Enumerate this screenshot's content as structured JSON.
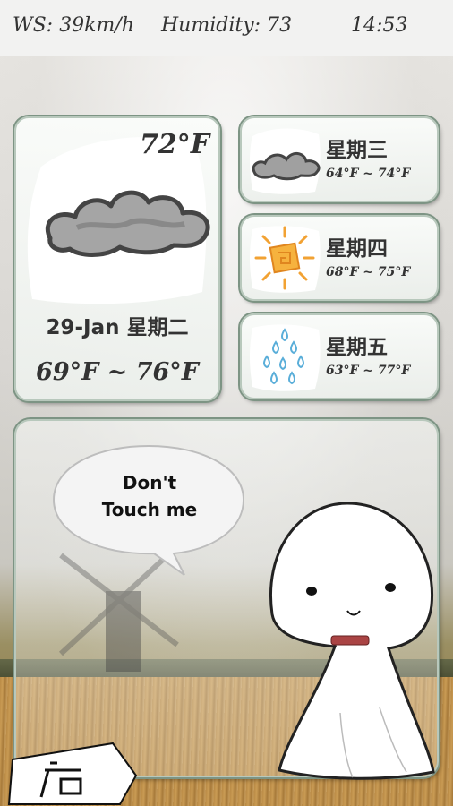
{
  "status_bar": {
    "wind_speed": "WS: 39km/h",
    "humidity": "Humidity: 73",
    "time": "14:53"
  },
  "today": {
    "current_temp": "72°F",
    "date": "29-Jan 星期二",
    "range": "69°F ~ 76°F",
    "icon": "cloudy-icon"
  },
  "forecast": [
    {
      "day": "星期三",
      "range": "64°F ~ 74°F",
      "icon": "cloud-icon"
    },
    {
      "day": "星期四",
      "range": "68°F ~ 75°F",
      "icon": "sun-icon"
    },
    {
      "day": "星期五",
      "range": "63°F ~ 77°F",
      "icon": "rain-icon"
    }
  ],
  "speech_bubble": {
    "line1": "Don't",
    "line2": "Touch me"
  },
  "store_button": {
    "label": "店"
  },
  "colors": {
    "card_border": "#7d9484",
    "text": "#333333",
    "sun": "#f2a233",
    "rain": "#5aaed9"
  }
}
